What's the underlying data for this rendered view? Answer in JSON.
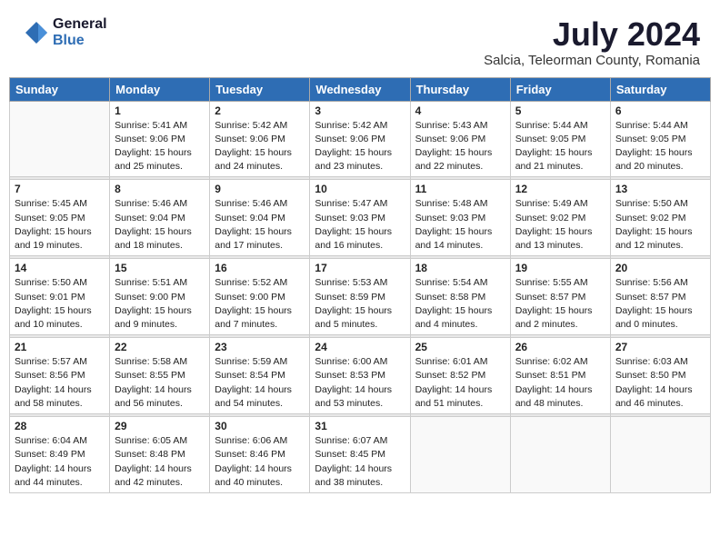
{
  "header": {
    "logo": {
      "general": "General",
      "blue": "Blue"
    },
    "title": "July 2024",
    "location": "Salcia, Teleorman County, Romania"
  },
  "days_of_week": [
    "Sunday",
    "Monday",
    "Tuesday",
    "Wednesday",
    "Thursday",
    "Friday",
    "Saturday"
  ],
  "weeks": [
    [
      {
        "day": "",
        "info": ""
      },
      {
        "day": "1",
        "info": "Sunrise: 5:41 AM\nSunset: 9:06 PM\nDaylight: 15 hours\nand 25 minutes."
      },
      {
        "day": "2",
        "info": "Sunrise: 5:42 AM\nSunset: 9:06 PM\nDaylight: 15 hours\nand 24 minutes."
      },
      {
        "day": "3",
        "info": "Sunrise: 5:42 AM\nSunset: 9:06 PM\nDaylight: 15 hours\nand 23 minutes."
      },
      {
        "day": "4",
        "info": "Sunrise: 5:43 AM\nSunset: 9:06 PM\nDaylight: 15 hours\nand 22 minutes."
      },
      {
        "day": "5",
        "info": "Sunrise: 5:44 AM\nSunset: 9:05 PM\nDaylight: 15 hours\nand 21 minutes."
      },
      {
        "day": "6",
        "info": "Sunrise: 5:44 AM\nSunset: 9:05 PM\nDaylight: 15 hours\nand 20 minutes."
      }
    ],
    [
      {
        "day": "7",
        "info": "Sunrise: 5:45 AM\nSunset: 9:05 PM\nDaylight: 15 hours\nand 19 minutes."
      },
      {
        "day": "8",
        "info": "Sunrise: 5:46 AM\nSunset: 9:04 PM\nDaylight: 15 hours\nand 18 minutes."
      },
      {
        "day": "9",
        "info": "Sunrise: 5:46 AM\nSunset: 9:04 PM\nDaylight: 15 hours\nand 17 minutes."
      },
      {
        "day": "10",
        "info": "Sunrise: 5:47 AM\nSunset: 9:03 PM\nDaylight: 15 hours\nand 16 minutes."
      },
      {
        "day": "11",
        "info": "Sunrise: 5:48 AM\nSunset: 9:03 PM\nDaylight: 15 hours\nand 14 minutes."
      },
      {
        "day": "12",
        "info": "Sunrise: 5:49 AM\nSunset: 9:02 PM\nDaylight: 15 hours\nand 13 minutes."
      },
      {
        "day": "13",
        "info": "Sunrise: 5:50 AM\nSunset: 9:02 PM\nDaylight: 15 hours\nand 12 minutes."
      }
    ],
    [
      {
        "day": "14",
        "info": "Sunrise: 5:50 AM\nSunset: 9:01 PM\nDaylight: 15 hours\nand 10 minutes."
      },
      {
        "day": "15",
        "info": "Sunrise: 5:51 AM\nSunset: 9:00 PM\nDaylight: 15 hours\nand 9 minutes."
      },
      {
        "day": "16",
        "info": "Sunrise: 5:52 AM\nSunset: 9:00 PM\nDaylight: 15 hours\nand 7 minutes."
      },
      {
        "day": "17",
        "info": "Sunrise: 5:53 AM\nSunset: 8:59 PM\nDaylight: 15 hours\nand 5 minutes."
      },
      {
        "day": "18",
        "info": "Sunrise: 5:54 AM\nSunset: 8:58 PM\nDaylight: 15 hours\nand 4 minutes."
      },
      {
        "day": "19",
        "info": "Sunrise: 5:55 AM\nSunset: 8:57 PM\nDaylight: 15 hours\nand 2 minutes."
      },
      {
        "day": "20",
        "info": "Sunrise: 5:56 AM\nSunset: 8:57 PM\nDaylight: 15 hours\nand 0 minutes."
      }
    ],
    [
      {
        "day": "21",
        "info": "Sunrise: 5:57 AM\nSunset: 8:56 PM\nDaylight: 14 hours\nand 58 minutes."
      },
      {
        "day": "22",
        "info": "Sunrise: 5:58 AM\nSunset: 8:55 PM\nDaylight: 14 hours\nand 56 minutes."
      },
      {
        "day": "23",
        "info": "Sunrise: 5:59 AM\nSunset: 8:54 PM\nDaylight: 14 hours\nand 54 minutes."
      },
      {
        "day": "24",
        "info": "Sunrise: 6:00 AM\nSunset: 8:53 PM\nDaylight: 14 hours\nand 53 minutes."
      },
      {
        "day": "25",
        "info": "Sunrise: 6:01 AM\nSunset: 8:52 PM\nDaylight: 14 hours\nand 51 minutes."
      },
      {
        "day": "26",
        "info": "Sunrise: 6:02 AM\nSunset: 8:51 PM\nDaylight: 14 hours\nand 48 minutes."
      },
      {
        "day": "27",
        "info": "Sunrise: 6:03 AM\nSunset: 8:50 PM\nDaylight: 14 hours\nand 46 minutes."
      }
    ],
    [
      {
        "day": "28",
        "info": "Sunrise: 6:04 AM\nSunset: 8:49 PM\nDaylight: 14 hours\nand 44 minutes."
      },
      {
        "day": "29",
        "info": "Sunrise: 6:05 AM\nSunset: 8:48 PM\nDaylight: 14 hours\nand 42 minutes."
      },
      {
        "day": "30",
        "info": "Sunrise: 6:06 AM\nSunset: 8:46 PM\nDaylight: 14 hours\nand 40 minutes."
      },
      {
        "day": "31",
        "info": "Sunrise: 6:07 AM\nSunset: 8:45 PM\nDaylight: 14 hours\nand 38 minutes."
      },
      {
        "day": "",
        "info": ""
      },
      {
        "day": "",
        "info": ""
      },
      {
        "day": "",
        "info": ""
      }
    ]
  ]
}
